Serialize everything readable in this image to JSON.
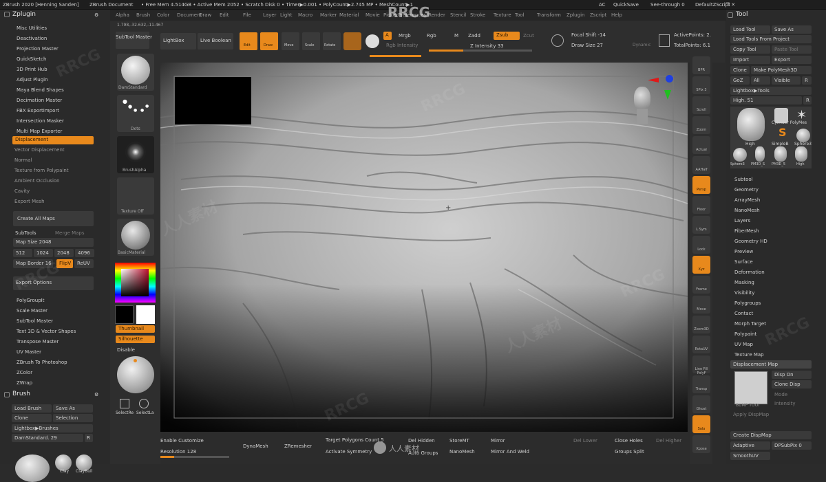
{
  "titlebar": {
    "left_text": "ZBrush 2020 [Henning Sanden]",
    "doc": "ZBrush Document",
    "stats": "• Free Mem 4.514GB • Active Mem 2052 • Scratch Disk 0 • Timer▶0.001 • PolyCount▶2.745 MP • MeshCount▶1",
    "ac": "AC",
    "quicksave": "QuickSave",
    "seethrough": "See-through 0",
    "defaultscript": "DefaultZScript",
    "window_controls": "– ❐ ✕"
  },
  "menus": [
    "Alpha",
    "Brush",
    "Color",
    "Document",
    "Draw",
    "Edit",
    "File",
    "Layer",
    "Light",
    "Macro",
    "Marker",
    "Material",
    "Movie",
    "Picker",
    "Preferences",
    "Render",
    "Stencil",
    "Stroke",
    "Texture",
    "Tool",
    "Transform",
    "Zplugin",
    "Zscript",
    "Help"
  ],
  "watermark_brand": "RRCG",
  "watermark_cn": "人人素材",
  "coords": "1.798,-32.632,-11.467",
  "zplugin": {
    "title": "Zplugin",
    "items_top": [
      "Misc Utilities",
      "Deactivation",
      "Projection Master",
      "QuickSketch",
      "3D Print Hub",
      "Adjust Plugin",
      "Maya Blend Shapes",
      "Decimation Master",
      "FBX ExportImport",
      "Intersection Masker",
      "Multi Map Exporter"
    ],
    "maps": [
      "Displacement",
      "Vector Displacement",
      "Normal",
      "Texture from Polypaint",
      "Ambient Occlusion",
      "Cavity",
      "Export Mesh"
    ],
    "create_all": "Create All Maps",
    "subtools": "SubTools",
    "merge_maps": "Merge Maps",
    "map_size_label": "Map Size",
    "map_size_value": "2048",
    "sizes": [
      "512",
      "1024",
      "2048",
      "4096"
    ],
    "map_border_label": "Map Border",
    "map_border_value": "16",
    "flipv": "FlipV",
    "reuv": "ReUV",
    "export_options": "Export Options",
    "items_bottom": [
      "PolyGroupIt",
      "Scale Master",
      "SubTool Master",
      "Text 3D & Vector Shapes",
      "Transpose Master",
      "UV Master",
      "ZBrush To Photoshop",
      "ZColor",
      "ZWrap"
    ]
  },
  "brush": {
    "title": "Brush",
    "load": "Load Brush",
    "save_as": "Save As",
    "clone": "Clone",
    "selection": "Selection",
    "lightbox": "Lightbox▶Brushes",
    "current": "DamStandard. 29",
    "r": "R",
    "thumbs": [
      "",
      "Clay",
      "ClayBuil"
    ]
  },
  "shelf": {
    "subtool_master": "SubTool Master",
    "lightbox": "LightBox",
    "live_boolean": "Live Boolean",
    "brush_name": "DamStandard",
    "stroke_name": "Dots",
    "alpha_name": "BrushAlpha",
    "texture_name": "Texture Off",
    "material_name": "BasicMaterial",
    "thumbnail": "Thumbnail",
    "silhouette": "Silhouette",
    "disable": "Disable",
    "selectrect": "SelectRe",
    "selectlasso": "SelectLa"
  },
  "toptools": {
    "edit": "Edit",
    "draw": "Draw",
    "move": "Move",
    "scale": "Scale",
    "rotate": "Rotate",
    "a": "A",
    "mrgb": "Mrgb",
    "rgb": "Rgb",
    "m": "M",
    "rgb_intensity": "Rgb Intensity",
    "zadd": "Zadd",
    "zsub": "Zsub",
    "zcut": "Zcut",
    "z_intensity": "Z Intensity 33",
    "z_intensity_frac": 0.33,
    "focal_shift": "Focal Shift -14",
    "draw_size": "Draw Size 27",
    "dynamic": "Dynamic",
    "active_points": "ActivePoints: 2.",
    "total_points": "TotalPoints: 6.1"
  },
  "right_shelf": [
    "BPR",
    "SPix 3",
    "Scroll",
    "Zoom",
    "Actual",
    "AAHalf",
    "Persp",
    "Floor",
    "L.Sym",
    "Lock",
    "Xyz",
    "Frame",
    "Move",
    "Zoom3D",
    "RotaUV",
    "Line Fill PolyF",
    "Transp",
    "Ghost",
    "Solo",
    "Xpose"
  ],
  "tool": {
    "title": "Tool",
    "load": "Load Tool",
    "save_as": "Save As",
    "load_project": "Load Tools From Project",
    "copy": "Copy Tool",
    "paste": "Paste Tool",
    "import": "Import",
    "export": "Export",
    "clone": "Clone",
    "make_polymesh": "Make PolyMesh3D",
    "goz": "GoZ",
    "all": "All",
    "visible": "Visible",
    "r": "R",
    "lightbox_tools": "Lightbox▶Tools",
    "high_label": "High. 51",
    "thumbs_row1": [
      "High",
      "Cylinder PolyMes"
    ],
    "thumbs_row1b": [
      "SimpleB",
      "Sphere3"
    ],
    "thumbs_row2": [
      "Sphere3",
      "PM3D_S",
      "PM3D_5",
      "High"
    ],
    "sections": [
      "Subtool",
      "Geometry",
      "ArrayMesh",
      "NanoMesh",
      "Layers",
      "FiberMesh",
      "Geometry HD",
      "Preview",
      "Surface",
      "Deformation",
      "Masking",
      "Visibility",
      "Polygroups",
      "Contact",
      "Morph Target",
      "Polypaint",
      "UV Map",
      "Texture Map"
    ],
    "disp_map": "Displacement Map",
    "disp_on": "Disp On",
    "clone_disp": "Clone Disp",
    "thumb_label": "BUMP TOOI",
    "mode": "Mode",
    "intensity": "Intensity",
    "apply_dispmap": "Apply DispMap",
    "create_dispmap": "Create DispMap",
    "adaptive": "Adaptive",
    "dpsubpix": "DPSubPix 0",
    "smoothuv": "SmoothUV",
    "r2": "R"
  },
  "bottom": {
    "enable_customize": "Enable Customize",
    "resolution": "Resolution 128",
    "dynamesh": "DynaMesh",
    "zremesher": "ZRemesher",
    "target_poly": "Target Polygons Count 5",
    "activate_sym": "Activate Symmetry",
    "del_hidden": "Del Hidden",
    "store_mt": "StoreMT",
    "mirror": "Mirror",
    "mirror_weld": "Mirror And Weld",
    "auto_groups": "Auto Groups",
    "nanomesh": "NanoMesh",
    "del_lower": "Del Lower",
    "close_holes": "Close Holes",
    "del_higher": "Del Higher",
    "groups_split": "Groups Split"
  }
}
